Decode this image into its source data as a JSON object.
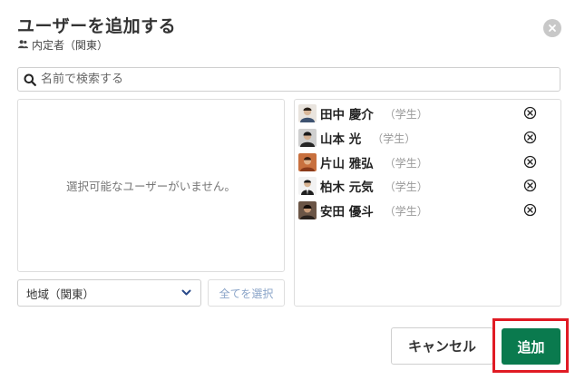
{
  "dialog": {
    "title": "ユーザーを追加する",
    "subtitle": "内定者（関東）",
    "subtitle_icon": "group-icon"
  },
  "search": {
    "placeholder": "名前で検索する",
    "value": ""
  },
  "available": {
    "empty_message": "選択可能なユーザーがいません。"
  },
  "filter": {
    "selected": "地域（関東）",
    "select_all_label": "全てを選択"
  },
  "selected_users": [
    {
      "name": "田中 慶介",
      "role": "（学生）",
      "avatar_color": "#c9b8a6"
    },
    {
      "name": "山本 光",
      "role": "（学生）",
      "avatar_color": "#3a3a3a"
    },
    {
      "name": "片山 雅弘",
      "role": "（学生）",
      "avatar_color": "#c8703e"
    },
    {
      "name": "柏木 元気",
      "role": "（学生）",
      "avatar_color": "#2b2b2b"
    },
    {
      "name": "安田 優斗",
      "role": "（学生）",
      "avatar_color": "#4a3a30"
    }
  ],
  "actions": {
    "cancel_label": "キャンセル",
    "add_label": "追加"
  },
  "colors": {
    "primary": "#0a7a4e",
    "highlight": "#e01b24",
    "select_all_text": "#8aa4c8"
  }
}
